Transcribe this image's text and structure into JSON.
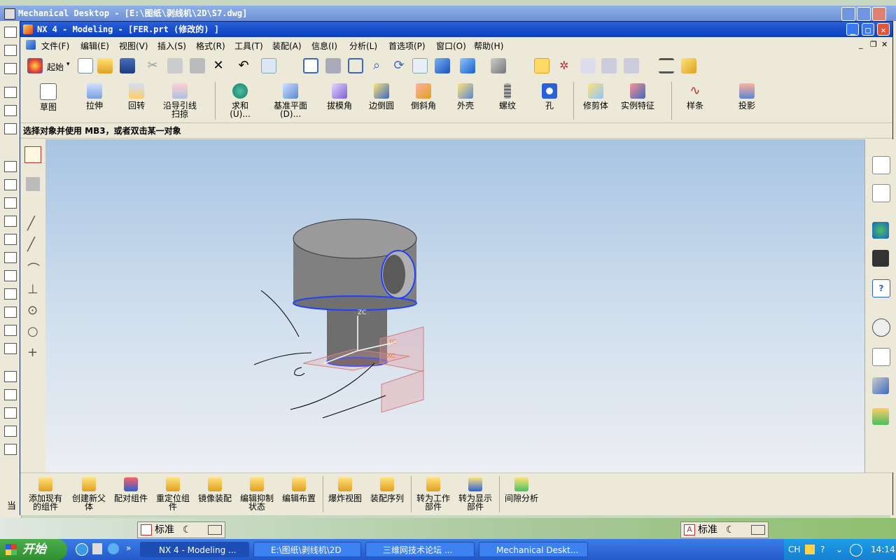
{
  "background_window": {
    "title": "Mechanical Desktop - [E:\\图纸\\剥线机\\2D\\S7.dwg]"
  },
  "window": {
    "title": "NX 4 - Modeling - [FER.prt  (修改的) ]"
  },
  "menu": [
    "文件(F)",
    "编辑(E)",
    "视图(V)",
    "插入(S)",
    "格式(R)",
    "工具(T)",
    "装配(A)",
    "信息(I)",
    "分析(L)",
    "首选项(P)",
    "窗口(O)",
    "帮助(H)"
  ],
  "toolbar": {
    "start_label": "起始"
  },
  "features": {
    "sketch": "草图",
    "extrude": "拉伸",
    "revolve": "回转",
    "sweep": [
      "沿导引线",
      "扫掠"
    ],
    "unite": [
      "求和",
      "(U)..."
    ],
    "datum_plane": [
      "基准平面",
      "(D)..."
    ],
    "draft": "拔模角",
    "edge_blend": "边倒圆",
    "chamfer": "倒斜角",
    "shell": "外壳",
    "thread": "螺纹",
    "hole": "孔",
    "trim_body": "修剪体",
    "instance": "实例特征",
    "spline": "样条",
    "project": "投影"
  },
  "status_text": "选择对象并使用 MB3，或者双击某一对象",
  "viewport": {
    "axis_labels": {
      "zc": "ZC",
      "yc": "YC",
      "xc": "XC"
    }
  },
  "assembly_tools": [
    [
      "添加现有",
      "的组件"
    ],
    [
      "创建新父",
      "体"
    ],
    [
      "配对组件"
    ],
    [
      "重定位组",
      "件"
    ],
    [
      "镜像装配"
    ],
    [
      "编辑抑制",
      "状态"
    ],
    [
      "编辑布置"
    ],
    [
      "爆炸视图"
    ],
    [
      "装配序列"
    ],
    [
      "转为工作",
      "部件"
    ],
    [
      "转为显示",
      "部件"
    ],
    [
      "间隙分析"
    ]
  ],
  "ime": {
    "mode_label": "标准"
  },
  "left_clipped_text": "当",
  "taskbar": {
    "start": "开始",
    "tasks": [
      "NX 4 - Modeling ...",
      "E:\\图纸\\剥线机\\2D",
      "三维网技术论坛 ...",
      "Mechanical Deskt..."
    ],
    "lang": "CH",
    "clock": "14:14"
  },
  "colors": {
    "title_blue": "#0b3fc0",
    "viewport_top": "#a8c4e2",
    "taskbar": "#2459c8",
    "start_green": "#2f8f2f"
  }
}
